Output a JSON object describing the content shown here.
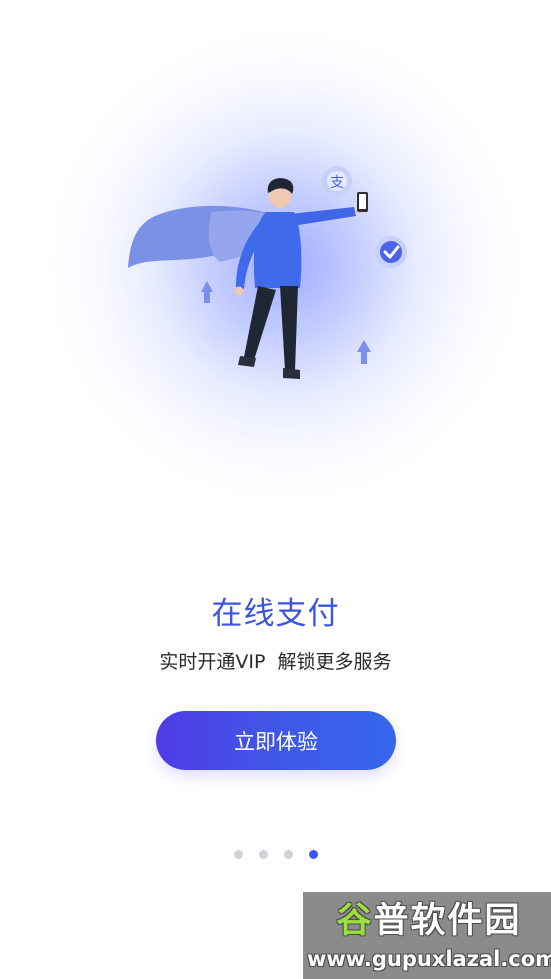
{
  "onboarding": {
    "title": "在线支付",
    "subtitle": "实时开通VIP  解锁更多服务",
    "cta_label": "立即体验",
    "page_index": 4,
    "page_count": 4
  },
  "illustration": {
    "alipay_glyph": "支",
    "scene": "superhero-with-phone"
  },
  "watermark": {
    "cn_accent": "谷",
    "cn_rest": "普软件园",
    "url": "www.gupuxlazal.com"
  },
  "colors": {
    "accent": "#3c55e0",
    "button_start": "#4e3be6",
    "button_end": "#3566ec",
    "dot_inactive": "#cfd2d8",
    "dot_active": "#3b59ea"
  }
}
